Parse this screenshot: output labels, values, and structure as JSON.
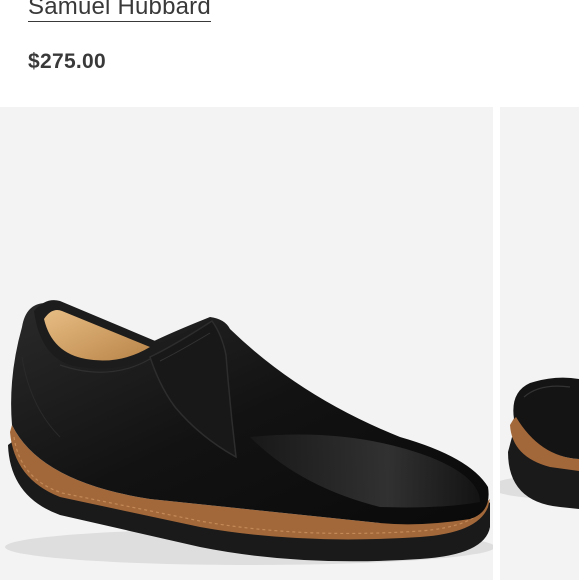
{
  "product": {
    "brand": "Samuel Hubbard",
    "price": "$275.00"
  },
  "gallery": {
    "images": [
      {
        "name": "black slip-on loafer, side view",
        "colors": {
          "leather": "#141414",
          "welt": "#a3683a",
          "sole": "#1a1a1a",
          "lining": "#d8a868"
        }
      },
      {
        "name": "black slip-on loafer, partial next image"
      }
    ]
  }
}
